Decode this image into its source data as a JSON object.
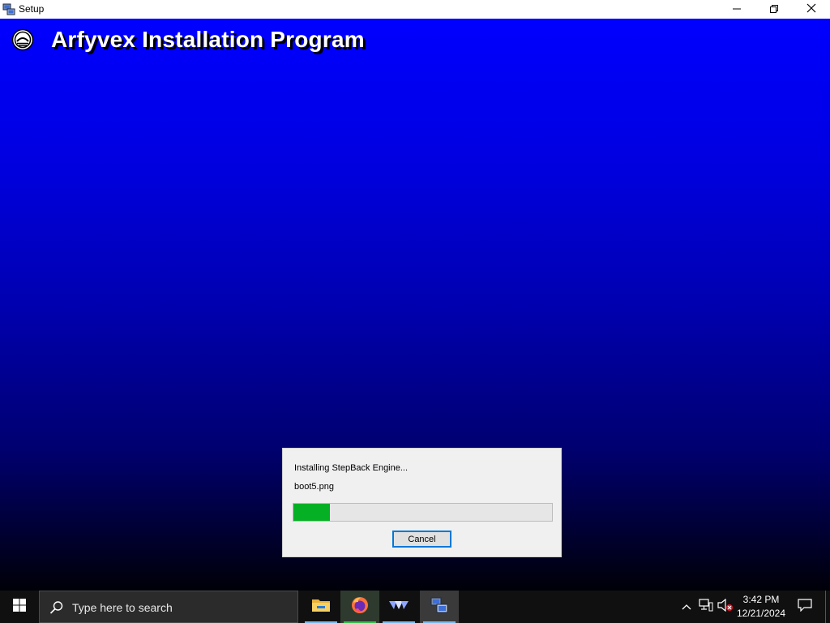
{
  "window": {
    "title": "Setup",
    "icons": {
      "app": "setup-computer-icon",
      "minimize": "minimize-icon",
      "maximize": "restore-icon",
      "close": "close-icon"
    }
  },
  "setup": {
    "heading": "Arfyvex Installation Program",
    "logo": "arfyvex-logo-icon"
  },
  "dialog": {
    "status_text": "Installing StepBack Engine...",
    "current_file": "boot5.png",
    "progress_percent": 14,
    "cancel_label": "Cancel",
    "colors": {
      "progress_fill": "#06b025",
      "button_border": "#0078d7"
    }
  },
  "taskbar": {
    "search_placeholder": "Type here to search",
    "apps": [
      "file-explorer-icon",
      "firefox-icon",
      "app-icon",
      "setup-icon"
    ],
    "tray_icons": [
      "chevron-up-icon",
      "network-icon",
      "volume-muted-icon"
    ],
    "time": "3:42 PM",
    "date": "12/21/2024"
  }
}
